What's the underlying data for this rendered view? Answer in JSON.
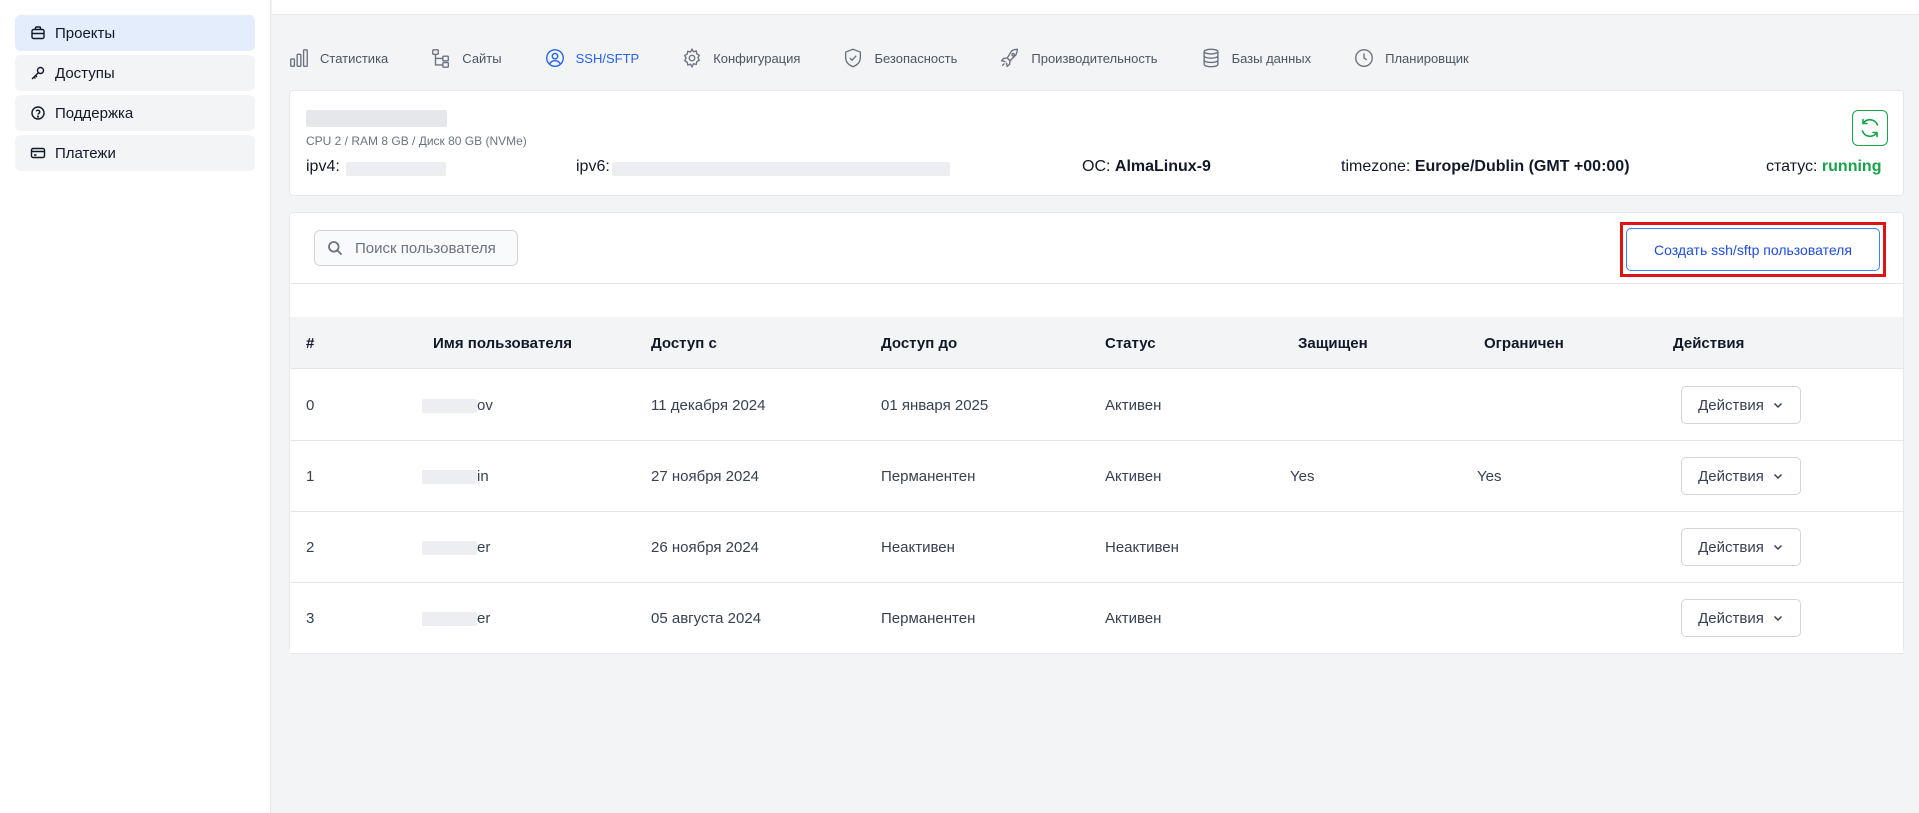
{
  "sidebar": {
    "items": [
      {
        "label": "Проекты",
        "icon": "briefcase-icon",
        "active": true
      },
      {
        "label": "Доступы",
        "icon": "key-icon",
        "active": false
      },
      {
        "label": "Поддержка",
        "icon": "help-circle-icon",
        "active": false
      },
      {
        "label": "Платежи",
        "icon": "credit-card-icon",
        "active": false
      }
    ]
  },
  "tabs": [
    {
      "label": "Статистика",
      "icon": "bar-chart-icon"
    },
    {
      "label": "Сайты",
      "icon": "sitemap-icon"
    },
    {
      "label": "SSH/SFTP",
      "icon": "user-circle-icon",
      "active": true
    },
    {
      "label": "Конфигурация",
      "icon": "gear-icon"
    },
    {
      "label": "Безопасность",
      "icon": "shield-check-icon"
    },
    {
      "label": "Производительность",
      "icon": "rocket-icon"
    },
    {
      "label": "Базы данных",
      "icon": "database-icon"
    },
    {
      "label": "Планировщик",
      "icon": "clock-icon"
    }
  ],
  "server": {
    "spec": "CPU 2 / RAM 8 GB / Диск 80 GB (NVMe)",
    "ipv4_label": "ipv4:",
    "ipv6_label": "ipv6:",
    "os_label": "ОС:",
    "os_value": "AlmaLinux-9",
    "tz_label": "timezone:",
    "tz_value": "Europe/Dublin (GMT +00:00)",
    "status_label": "статус:",
    "status_value": "running",
    "status_color": "#16a34a"
  },
  "users": {
    "search_placeholder": "Поиск пользователя",
    "create_label": "Создать ssh/sftp пользователя",
    "highlight_color": "#dc1414",
    "columns": [
      "#",
      "Имя пользователя",
      "Доступ с",
      "Доступ до",
      "Статус",
      "Защищен",
      "Ограничен",
      "Действия"
    ],
    "rows": [
      {
        "num": "0",
        "name_suffix": "ov",
        "from": "11 декабря 2024",
        "to": "01 января 2025",
        "status": "Активен",
        "protected": "",
        "limited": "",
        "action": "Действия"
      },
      {
        "num": "1",
        "name_suffix": "in",
        "from": "27 ноября 2024",
        "to": "Перманентен",
        "status": "Активен",
        "protected": "Yes",
        "limited": "Yes",
        "action": "Действия"
      },
      {
        "num": "2",
        "name_suffix": "er",
        "from": "26 ноября 2024",
        "to": "Неактивен",
        "status": "Неактивен",
        "protected": "",
        "limited": "",
        "action": "Действия"
      },
      {
        "num": "3",
        "name_suffix": "er",
        "from": "05 августа 2024",
        "to": "Перманентен",
        "status": "Активен",
        "protected": "",
        "limited": "",
        "action": "Действия"
      }
    ]
  }
}
